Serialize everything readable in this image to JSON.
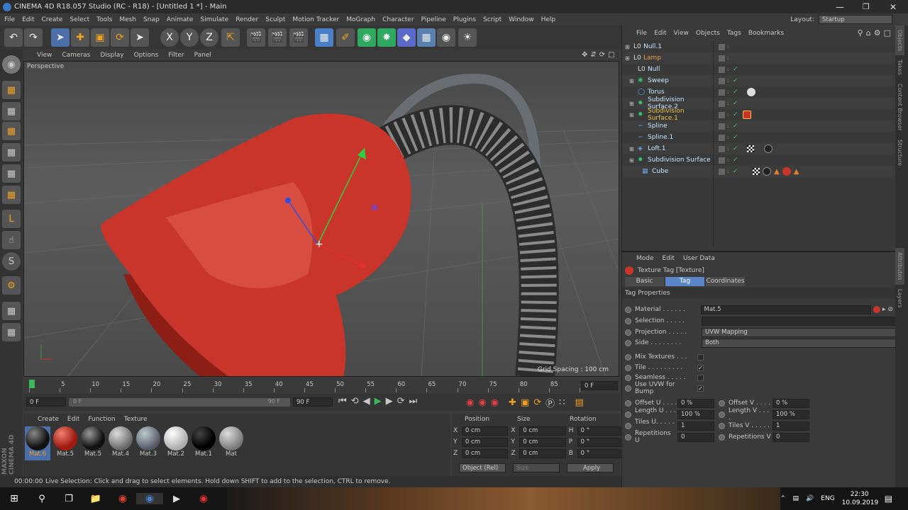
{
  "window": {
    "title": "CINEMA 4D R18.057 Studio (RC - R18) - [Untitled 1 *] - Main"
  },
  "menu": [
    "File",
    "Edit",
    "Create",
    "Select",
    "Tools",
    "Mesh",
    "Snap",
    "Animate",
    "Simulate",
    "Render",
    "Sculpt",
    "Motion Tracker",
    "MoGraph",
    "Character",
    "Pipeline",
    "Plugins",
    "Script",
    "Window",
    "Help"
  ],
  "layout": {
    "label": "Layout:",
    "value": "Startup"
  },
  "viewport": {
    "menu": [
      "View",
      "Cameras",
      "Display",
      "Options",
      "Filter",
      "Panel"
    ],
    "camera_label": "Perspective",
    "grid_spacing": "Grid Spacing : 100 cm"
  },
  "timeline": {
    "ticks": [
      "0",
      "5",
      "10",
      "15",
      "20",
      "25",
      "30",
      "35",
      "40",
      "45",
      "50",
      "55",
      "60",
      "65",
      "70",
      "75",
      "80",
      "85",
      "90"
    ],
    "current_frame": "0 F",
    "start_frame": "0 F",
    "end_frame": "90 F",
    "range_start": "0 F",
    "range_end": "90 F"
  },
  "materials": {
    "menu": [
      "Create",
      "Edit",
      "Function",
      "Texture"
    ],
    "items": [
      "Mat.6",
      "Mat.5",
      "Mat.5",
      "Mat.4",
      "Mat.3",
      "Mat.2",
      "Mat.1",
      "Mat"
    ]
  },
  "coords": {
    "headers": [
      "Position",
      "Size",
      "Rotation"
    ],
    "rows": [
      {
        "axis": "X",
        "pos": "0 cm",
        "size_axis": "X",
        "size": "0 cm",
        "rot_axis": "H",
        "rot": "0 °"
      },
      {
        "axis": "Y",
        "pos": "0 cm",
        "size_axis": "Y",
        "size": "0 cm",
        "rot_axis": "P",
        "rot": "0 °"
      },
      {
        "axis": "Z",
        "pos": "0 cm",
        "size_axis": "Z",
        "size": "0 cm",
        "rot_axis": "B",
        "rot": "0 °"
      }
    ],
    "mode": "Object (Rel)",
    "size_mode": "Size",
    "apply": "Apply"
  },
  "status": {
    "time": "00:00:00",
    "message": "Live Selection: Click and drag to select elements. Hold down SHIFT to add to the selection, CTRL to remove."
  },
  "objects": {
    "menu": [
      "File",
      "Edit",
      "View",
      "Objects",
      "Tags",
      "Bookmarks"
    ],
    "items": [
      {
        "name": "Null.1",
        "indent": 0
      },
      {
        "name": "Lamp",
        "indent": 0
      },
      {
        "name": "Null",
        "indent": 1
      },
      {
        "name": "Sweep",
        "indent": 1
      },
      {
        "name": "Torus",
        "indent": 1
      },
      {
        "name": "Subdivision Surface.2",
        "indent": 1
      },
      {
        "name": "Subdivision Surface.1",
        "indent": 1
      },
      {
        "name": "Spline",
        "indent": 1
      },
      {
        "name": "Spline.1",
        "indent": 1
      },
      {
        "name": "Loft.1",
        "indent": 1
      },
      {
        "name": "Subdivision Surface",
        "indent": 1
      },
      {
        "name": "Cube",
        "indent": 2
      }
    ]
  },
  "attributes": {
    "menu": [
      "Mode",
      "Edit",
      "User Data"
    ],
    "title": "Texture Tag [Texture]",
    "tabs": [
      "Basic",
      "Tag",
      "Coordinates"
    ],
    "section": "Tag Properties",
    "material_label": "Material . . . . . .",
    "material_value": "Mat.5",
    "selection_label": "Selection . . . . .",
    "projection_label": "Projection . . . . .",
    "projection_value": "UVW Mapping",
    "side_label": "Side . . . . . . . .",
    "side_value": "Both",
    "mix_label": "Mix Textures . . .",
    "tile_label": "Tile . . . . . . . . .",
    "seamless_label": "Seamless . . . . .",
    "uvwbump_label": "Use UVW for Bump",
    "offset_u_label": "Offset U . . . .",
    "offset_u": "0 %",
    "offset_v_label": "Offset V . . . .",
    "offset_v": "0 %",
    "length_u_label": "Length U . . . .",
    "length_u": "100 %",
    "length_v_label": "Length V . . . .",
    "length_v": "100 %",
    "tiles_u_label": "Tiles U. . . . . .",
    "tiles_u": "1",
    "tiles_v_label": "Tiles V . . . . .",
    "tiles_v": "1",
    "rep_u_label": "Repetitions U",
    "rep_u": "0",
    "rep_v_label": "Repetitions V",
    "rep_v": "0"
  },
  "side_tabs": [
    "Objects",
    "Takes",
    "Content Browser",
    "Structure",
    "Attributes",
    "Layers"
  ],
  "taskbar": {
    "lang": "ENG",
    "time": "22:30",
    "date": "10.09.2019"
  },
  "colors": {
    "accent": "#5a85c8",
    "lamp": "#d4392a",
    "selected_object": "#e8a040"
  }
}
